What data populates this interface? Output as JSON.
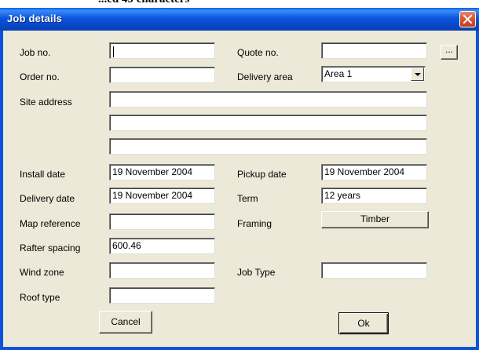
{
  "background_text": "...ed 49 characters",
  "window": {
    "title": "Job details"
  },
  "labels": {
    "job_no": "Job no.",
    "quote_no": "Quote no.",
    "order_no": "Order no.",
    "delivery_area": "Delivery area",
    "site_address": "Site address",
    "install_date": "Install date",
    "pickup_date": "Pickup date",
    "delivery_date": "Delivery date",
    "term": "Term",
    "map_reference": "Map reference",
    "framing": "Framing",
    "rafter_spacing": "Rafter spacing",
    "wind_zone": "Wind zone",
    "job_type": "Job Type",
    "roof_type": "Roof type"
  },
  "fields": {
    "job_no": "",
    "quote_no": "",
    "order_no": "",
    "delivery_area": "Area 1",
    "site_address_1": "",
    "site_address_2": "",
    "site_address_3": "",
    "install_date": "19 November 2004",
    "pickup_date": "19 November 2004",
    "delivery_date": "19 November 2004",
    "term": "12 years",
    "map_reference": "",
    "rafter_spacing": "600.46",
    "wind_zone": "",
    "job_type": "",
    "roof_type": ""
  },
  "buttons": {
    "browse": "...",
    "framing": "Timber",
    "cancel": "Cancel",
    "ok": "Ok"
  },
  "icons": {
    "close": "close-x-icon",
    "dropdown": "chevron-down-icon"
  },
  "colors": {
    "title_bar": "#0a53d8",
    "close_button": "#d9542f",
    "dialog_background": "#ece9d8"
  }
}
